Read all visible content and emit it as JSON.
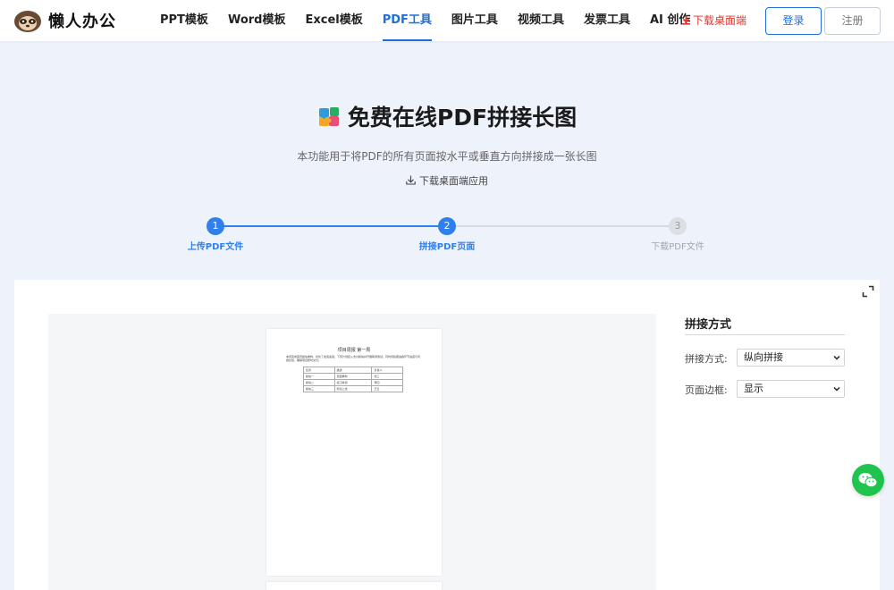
{
  "brand": {
    "name": "懒人办公"
  },
  "nav": {
    "items": [
      {
        "label": "PPT模板",
        "active": false
      },
      {
        "label": "Word模板",
        "active": false
      },
      {
        "label": "Excel模板",
        "active": false
      },
      {
        "label": "PDF工具",
        "active": true
      },
      {
        "label": "图片工具",
        "active": false
      },
      {
        "label": "视频工具",
        "active": false
      },
      {
        "label": "发票工具",
        "active": false
      },
      {
        "label": "AI 创作",
        "active": false
      }
    ],
    "download": "下载桌面端",
    "login": "登录",
    "register": "注册"
  },
  "hero": {
    "title": "免费在线PDF拼接长图",
    "subtitle": "本功能用于将PDF的所有页面按水平或垂直方向拼接成一张长图",
    "download_app": "下载桌面端应用"
  },
  "steps": [
    {
      "number": "1",
      "label": "上传PDF文件",
      "state": "done"
    },
    {
      "number": "2",
      "label": "拼接PDF页面",
      "state": "current"
    },
    {
      "number": "3",
      "label": "下载PDF文件",
      "state": "pending"
    }
  ],
  "settings": {
    "title": "拼接方式",
    "mode_label": "拼接方式:",
    "mode_value": "纵向拼接",
    "border_label": "页面边框:",
    "border_value": "显示"
  },
  "preview_doc": {
    "title": "项目周报 第一周",
    "paragraph": "本周完成首页模块重构，优化了加载速度；下周计划接入支付模块并开展联调测试，同时持续跟进各环节进度与问题反馈，确保项目按时交付。",
    "table": [
      [
        "任务",
        "描述",
        "负责人"
      ],
      [
        "模块一",
        "页面重构",
        "张三"
      ],
      [
        "模块二",
        "接口联调",
        "李四"
      ],
      [
        "模块三",
        "测试上线",
        "王五"
      ]
    ]
  },
  "colors": {
    "accent": "#1f6fd6",
    "step_active": "#2f80ed",
    "download_red": "#e0372c",
    "chat_green": "#1fc44e",
    "page_bg": "#eef3fb"
  }
}
